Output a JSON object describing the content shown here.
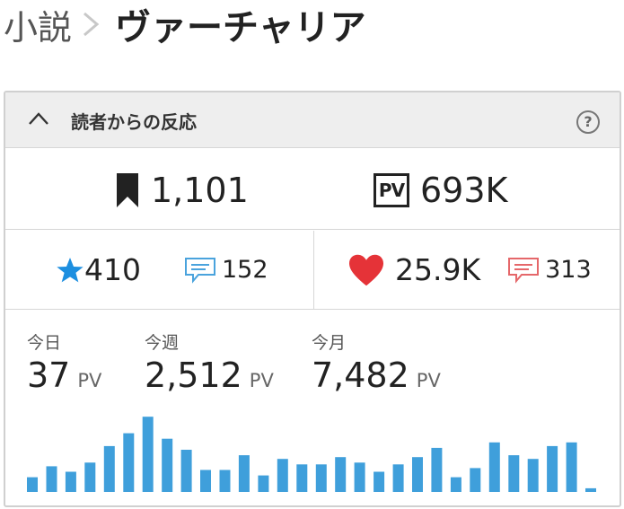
{
  "breadcrumb": {
    "parent": "小説",
    "current": "ヴァーチャリア"
  },
  "panel": {
    "title": "読者からの反応",
    "help_label": "?"
  },
  "totals": {
    "bookmarks": "1,101",
    "pv_badge": "PV",
    "pv": "693K"
  },
  "reactions": {
    "stars": "410",
    "star_comments": "152",
    "likes": "25.9K",
    "like_comments": "313"
  },
  "pv_stats": [
    {
      "label": "今日",
      "value": "37",
      "unit": "PV"
    },
    {
      "label": "今週",
      "value": "2,512",
      "unit": "PV"
    },
    {
      "label": "今月",
      "value": "7,482",
      "unit": "PV"
    }
  ],
  "colors": {
    "bar": "#3f9fdb",
    "star": "#1d8fe0",
    "heart": "#e53338",
    "star_comment": "#4aa3dd",
    "like_comment": "#e5676a"
  },
  "chart_data": {
    "type": "bar",
    "series": [
      {
        "values": [
          8,
          14,
          11,
          16,
          25,
          32,
          41,
          29,
          23,
          12,
          12,
          20,
          9,
          18,
          15,
          15,
          19,
          16,
          11,
          15,
          19,
          24,
          8,
          13,
          27,
          20,
          18,
          25,
          27,
          2
        ]
      }
    ],
    "ylim": [
      0,
      45
    ],
    "grid": false
  }
}
